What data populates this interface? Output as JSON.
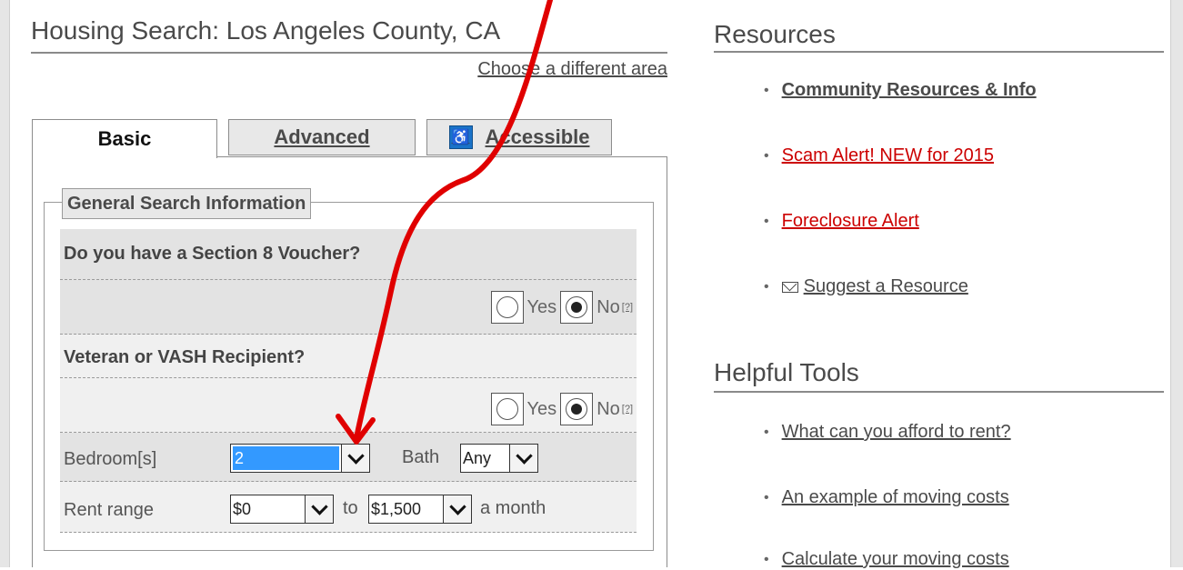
{
  "search": {
    "title": "Housing Search: Los Angeles County, CA",
    "change_area": "Choose a different area"
  },
  "tabs": [
    {
      "label": "Basic"
    },
    {
      "label": "Advanced"
    },
    {
      "label": "Accessible",
      "icon": "wheelchair-icon"
    }
  ],
  "form": {
    "legend": "General Search Information",
    "section8": {
      "question": "Do you have a Section 8 Voucher?",
      "yes": "Yes",
      "no": "No",
      "help": "[?]",
      "selected": "No"
    },
    "veteran": {
      "question": "Veteran or VASH Recipient?",
      "yes": "Yes",
      "no": "No",
      "help": "[?]",
      "selected": "No"
    },
    "bedrooms": {
      "label": "Bedroom[s]",
      "value": "2"
    },
    "bath": {
      "label": "Bath",
      "value": "Any"
    },
    "rent": {
      "label": "Rent range",
      "min": "$0",
      "to": "to",
      "max": "$1,500",
      "suffix": "a month"
    }
  },
  "resources": {
    "title": "Resources",
    "items": [
      {
        "label": "Community Resources & Info"
      },
      {
        "label": "Scam Alert! NEW for 2015"
      },
      {
        "label": "Foreclosure Alert"
      },
      {
        "label": "Suggest a Resource",
        "icon": "envelope-icon"
      }
    ]
  },
  "tools": {
    "title": "Helpful Tools",
    "items": [
      {
        "label": "What can you afford to rent?"
      },
      {
        "label": "An example of moving costs"
      },
      {
        "label": "Calculate your moving costs"
      }
    ]
  },
  "colors": {
    "annotation_arrow": "#e00000",
    "alert_link": "#cc0000",
    "selection": "#3399ff"
  }
}
